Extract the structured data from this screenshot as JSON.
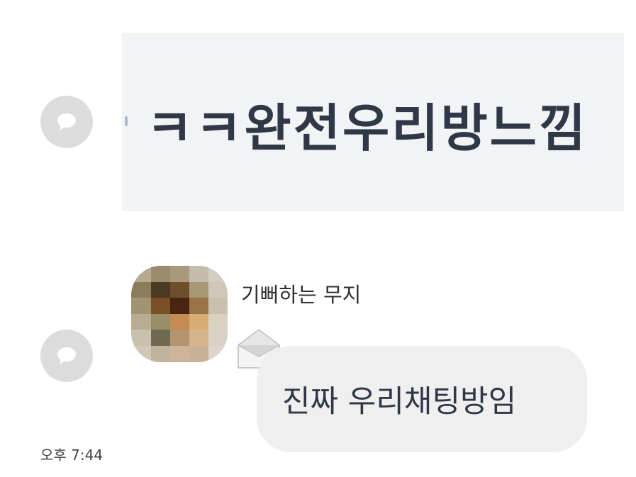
{
  "quoted_message": {
    "text": "ㅋㅋ완전우리방느낌"
  },
  "message": {
    "sender_name": "기뻐하는 무지",
    "text": "진짜 우리채팅방임",
    "timestamp": "오후 7:44"
  },
  "icons": {
    "reply": "speech-bubble-icon",
    "envelope": "open-envelope-icon"
  },
  "colors": {
    "quoted_background": "#f2f3f5",
    "bubble_background": "#efefef",
    "reply_icon_background": "#dcdcdc",
    "text_dark": "#2f3847"
  }
}
